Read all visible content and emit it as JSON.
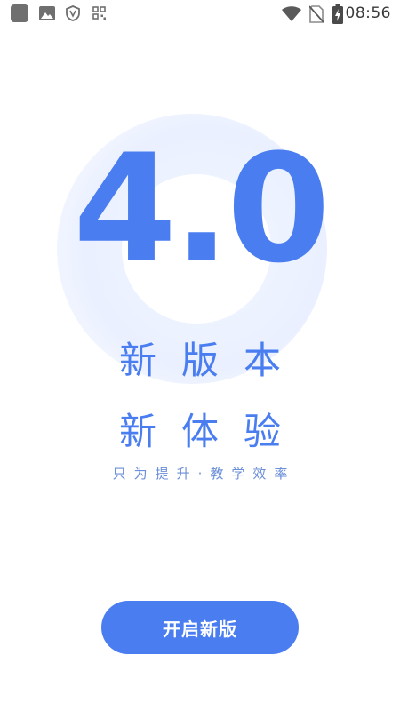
{
  "status_bar": {
    "time": "08:56",
    "icons": [
      "app-square-icon",
      "image-icon",
      "shield-icon",
      "grid-icon",
      "wifi-icon",
      "no-sim-icon",
      "battery-charging-icon"
    ]
  },
  "hero": {
    "version": "4.0",
    "headline_line1": "新版本",
    "headline_line2": "新体验",
    "tagline": "只为提升·教学效率"
  },
  "actions": {
    "start_label": "开启新版"
  },
  "colors": {
    "accent": "#4a7ef0",
    "ring": "#eaf0ff",
    "status_icons": "#6f6f6f"
  }
}
